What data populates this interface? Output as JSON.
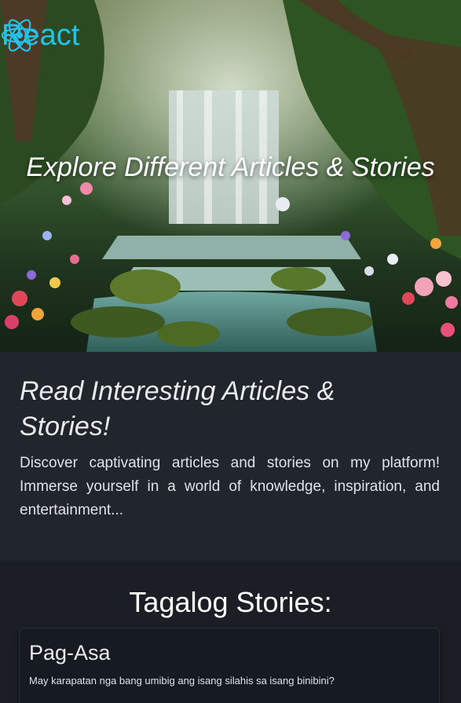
{
  "header": {
    "brand_text": "React",
    "logo_icon": "react-atom-icon",
    "brand_color": "#22c3e6"
  },
  "hero": {
    "title": "Explore Different Articles & Stories"
  },
  "intro": {
    "heading": "Read Interesting Articles & Stories!",
    "text": "Discover captivating articles and stories on my platform! Immerse yourself in a world of knowledge, inspiration, and entertainment..."
  },
  "stories": {
    "section_title": "Tagalog Stories:",
    "items": [
      {
        "title": "Pag-Asa",
        "description": "May karapatan nga bang umibig ang isang silahis sa isang binibini?"
      }
    ]
  }
}
